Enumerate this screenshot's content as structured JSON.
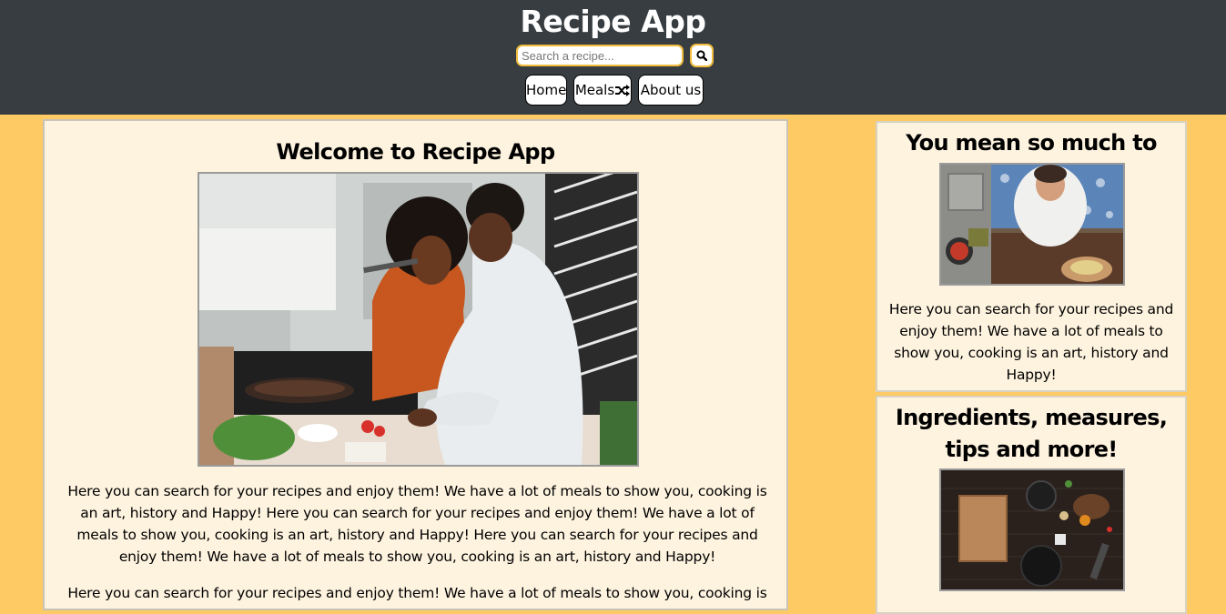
{
  "header": {
    "title": "Recipe App",
    "search": {
      "placeholder": "Search a recipe...",
      "value": "",
      "icon": "search-icon"
    },
    "nav": [
      {
        "label": "Home"
      },
      {
        "label": "Meals",
        "icon": "shuffle-icon"
      },
      {
        "label": "About us"
      }
    ]
  },
  "main": {
    "title": "Welcome to Recipe App",
    "paragraphs": [
      "Here you can search for your recipes and enjoy them! We have a lot of meals to show you, cooking is an art, history and Happy! Here you can search for your recipes and enjoy them! We have a lot of meals to show you, cooking is an art, history and Happy! Here you can search for your recipes and enjoy them! We have a lot of meals to show you, cooking is an art, history and Happy!",
      "Here you can search for your recipes and enjoy them! We have a lot of meals to show you, cooking is"
    ]
  },
  "sidebar": {
    "cards": [
      {
        "title": "You mean so much to us!",
        "text": "Here you can search for your recipes and enjoy them! We have a lot of meals to show you, cooking is an art, history and Happy!"
      },
      {
        "title": "Ingredients, measures, tips and more!"
      }
    ]
  },
  "colors": {
    "header_bg": "#373d40",
    "page_bg": "#fdca63",
    "card_bg": "#fef3df",
    "accent": "#f1bc3c"
  }
}
